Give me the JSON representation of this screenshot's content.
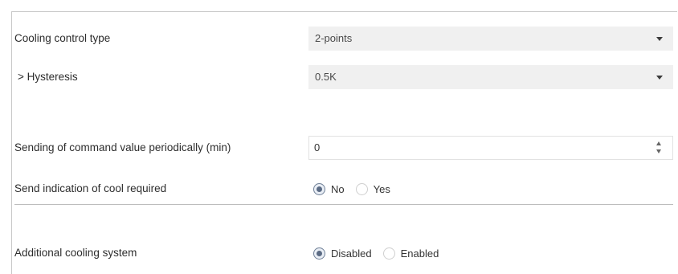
{
  "rows": {
    "cooling_control_type": {
      "label": "Cooling control type",
      "value": "2-points"
    },
    "hysteresis": {
      "label": "> Hysteresis",
      "value": "0.5K"
    },
    "sending_period": {
      "label": "Sending of command value periodically (min)",
      "value": "0"
    },
    "send_indication": {
      "label": "Send indication of cool required",
      "options": [
        "No",
        "Yes"
      ],
      "selected": "No"
    },
    "additional_cooling": {
      "label": "Additional cooling system",
      "options": [
        "Disabled",
        "Enabled"
      ],
      "selected": "Disabled"
    }
  },
  "icons": {
    "dropdown": "chevron-down-icon",
    "spinner": "spin-arrows-icon"
  }
}
